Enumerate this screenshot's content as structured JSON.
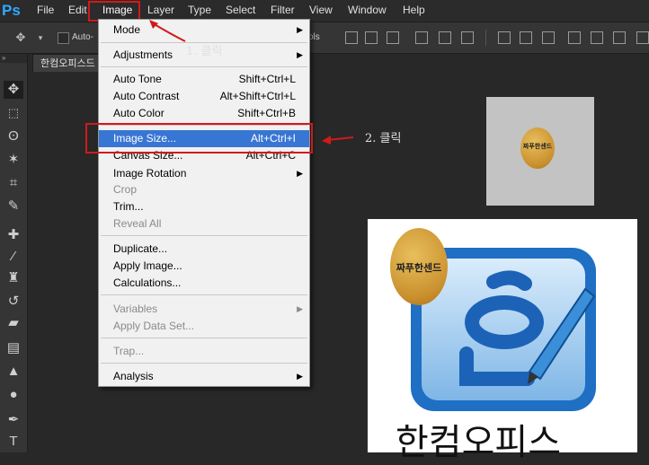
{
  "app": {
    "logo": "Ps"
  },
  "menubar": {
    "items": [
      "File",
      "Edit",
      "Image",
      "Layer",
      "Type",
      "Select",
      "Filter",
      "View",
      "Window",
      "Help"
    ],
    "active": "Image"
  },
  "options_bar": {
    "auto_select_label": "Auto-",
    "align_partial": "ols"
  },
  "document_tab": {
    "title": "한컴오피스드"
  },
  "image_menu": {
    "items": [
      {
        "label": "Mode",
        "submenu": true
      },
      {
        "label": "Adjustments",
        "submenu": true
      },
      {
        "label": "Auto Tone",
        "shortcut": "Shift+Ctrl+L"
      },
      {
        "label": "Auto Contrast",
        "shortcut": "Alt+Shift+Ctrl+L"
      },
      {
        "label": "Auto Color",
        "shortcut": "Shift+Ctrl+B"
      },
      {
        "label": "Image Size...",
        "shortcut": "Alt+Ctrl+I",
        "selected": true
      },
      {
        "label": "Canvas Size...",
        "shortcut": "Alt+Ctrl+C"
      },
      {
        "label": "Image Rotation",
        "submenu": true
      },
      {
        "label": "Crop",
        "disabled": true
      },
      {
        "label": "Trim..."
      },
      {
        "label": "Reveal All",
        "disabled": true
      },
      {
        "label": "Duplicate..."
      },
      {
        "label": "Apply Image..."
      },
      {
        "label": "Calculations..."
      },
      {
        "label": "Variables",
        "submenu": true,
        "disabled": true
      },
      {
        "label": "Apply Data Set...",
        "disabled": true
      },
      {
        "label": "Trap...",
        "disabled": true
      },
      {
        "label": "Analysis",
        "submenu": true
      }
    ]
  },
  "annotations": {
    "step1": "1. 클릭",
    "step2": "2. 클릭"
  },
  "canvas": {
    "cookie_text": "짜푸한센드",
    "logo_glyph": "한",
    "big_text": "한컴오피스"
  },
  "colors": {
    "menu_highlight": "#3876d3",
    "annotation_red": "#d11a1a",
    "logo_blue": "#2a7fd0"
  }
}
